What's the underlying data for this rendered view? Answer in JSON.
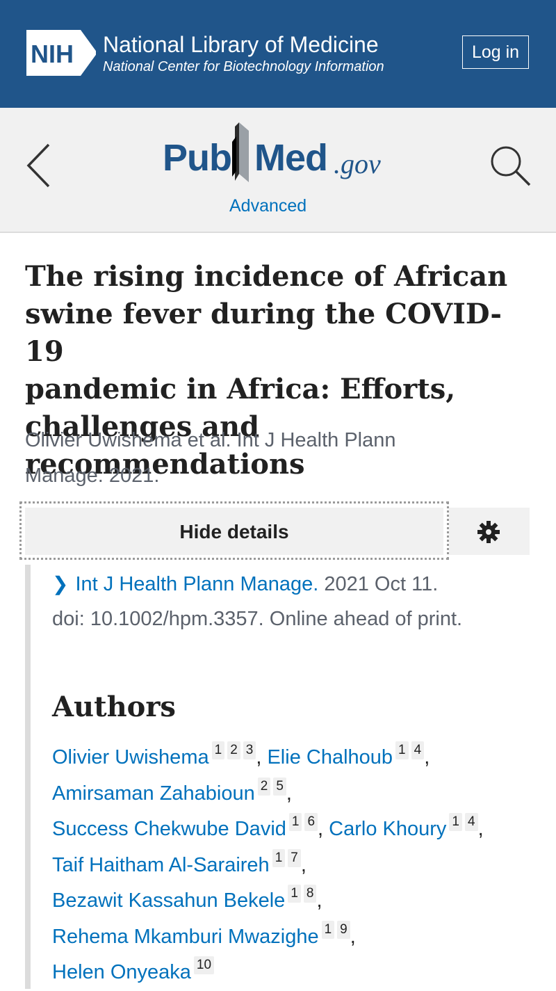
{
  "nih_header": {
    "logo_text": "NIH",
    "title": "National Library of Medicine",
    "subtitle": "National Center for Biotechnology Information",
    "login_label": "Log in",
    "bg_color": "#20558a"
  },
  "pubmed_bar": {
    "logo_pub": "Pub",
    "logo_med": "Med",
    "logo_gov": ".gov",
    "advanced_label": "Advanced",
    "back_icon": "chevron-left-icon",
    "search_icon": "search-icon"
  },
  "article": {
    "title_lines": [
      "The rising incidence of African",
      "swine fever during the COVID-19",
      "pandemic in Africa: Efforts,",
      "challenges and recommendations"
    ],
    "citation_line1": "Olivier Uwishema et al. Int J Health Plann",
    "citation_line2": "Manage. 2021.",
    "hide_details_label": "Hide details",
    "settings_icon": "gear-icon",
    "journal": "Int J Health Plann Manage.",
    "journal_date": " 2021 Oct 11.",
    "doi_line": "doi: 10.1002/hpm.3357. Online ahead of print.",
    "authors_heading": "Authors",
    "author_lines": [
      [
        {
          "name": "Olivier Uwishema",
          "affs": [
            "1",
            "2",
            "3"
          ],
          "sep": ", "
        },
        {
          "name": "Elie Chalhoub",
          "affs": [
            "1",
            "4"
          ],
          "sep": ","
        }
      ],
      [
        {
          "name": "Amirsaman Zahabioun",
          "affs": [
            "2",
            "5"
          ],
          "sep": ","
        }
      ],
      [
        {
          "name": "Success Chekwube David",
          "affs": [
            "1",
            "6"
          ],
          "sep": ", "
        },
        {
          "name": "Carlo Khoury",
          "affs": [
            "1",
            "4"
          ],
          "sep": ","
        }
      ],
      [
        {
          "name": "Taif Haitham Al-Saraireh",
          "affs": [
            "1",
            "7"
          ],
          "sep": ","
        }
      ],
      [
        {
          "name": "Bezawit Kassahun Bekele",
          "affs": [
            "1",
            "8"
          ],
          "sep": ","
        }
      ],
      [
        {
          "name": "Rehema Mkamburi Mwazighe",
          "affs": [
            "1",
            "9"
          ],
          "sep": ","
        }
      ],
      [
        {
          "name": "Helen Onyeaka",
          "affs": [
            "10"
          ],
          "sep": ""
        }
      ]
    ],
    "link_color": "#0071bc"
  }
}
